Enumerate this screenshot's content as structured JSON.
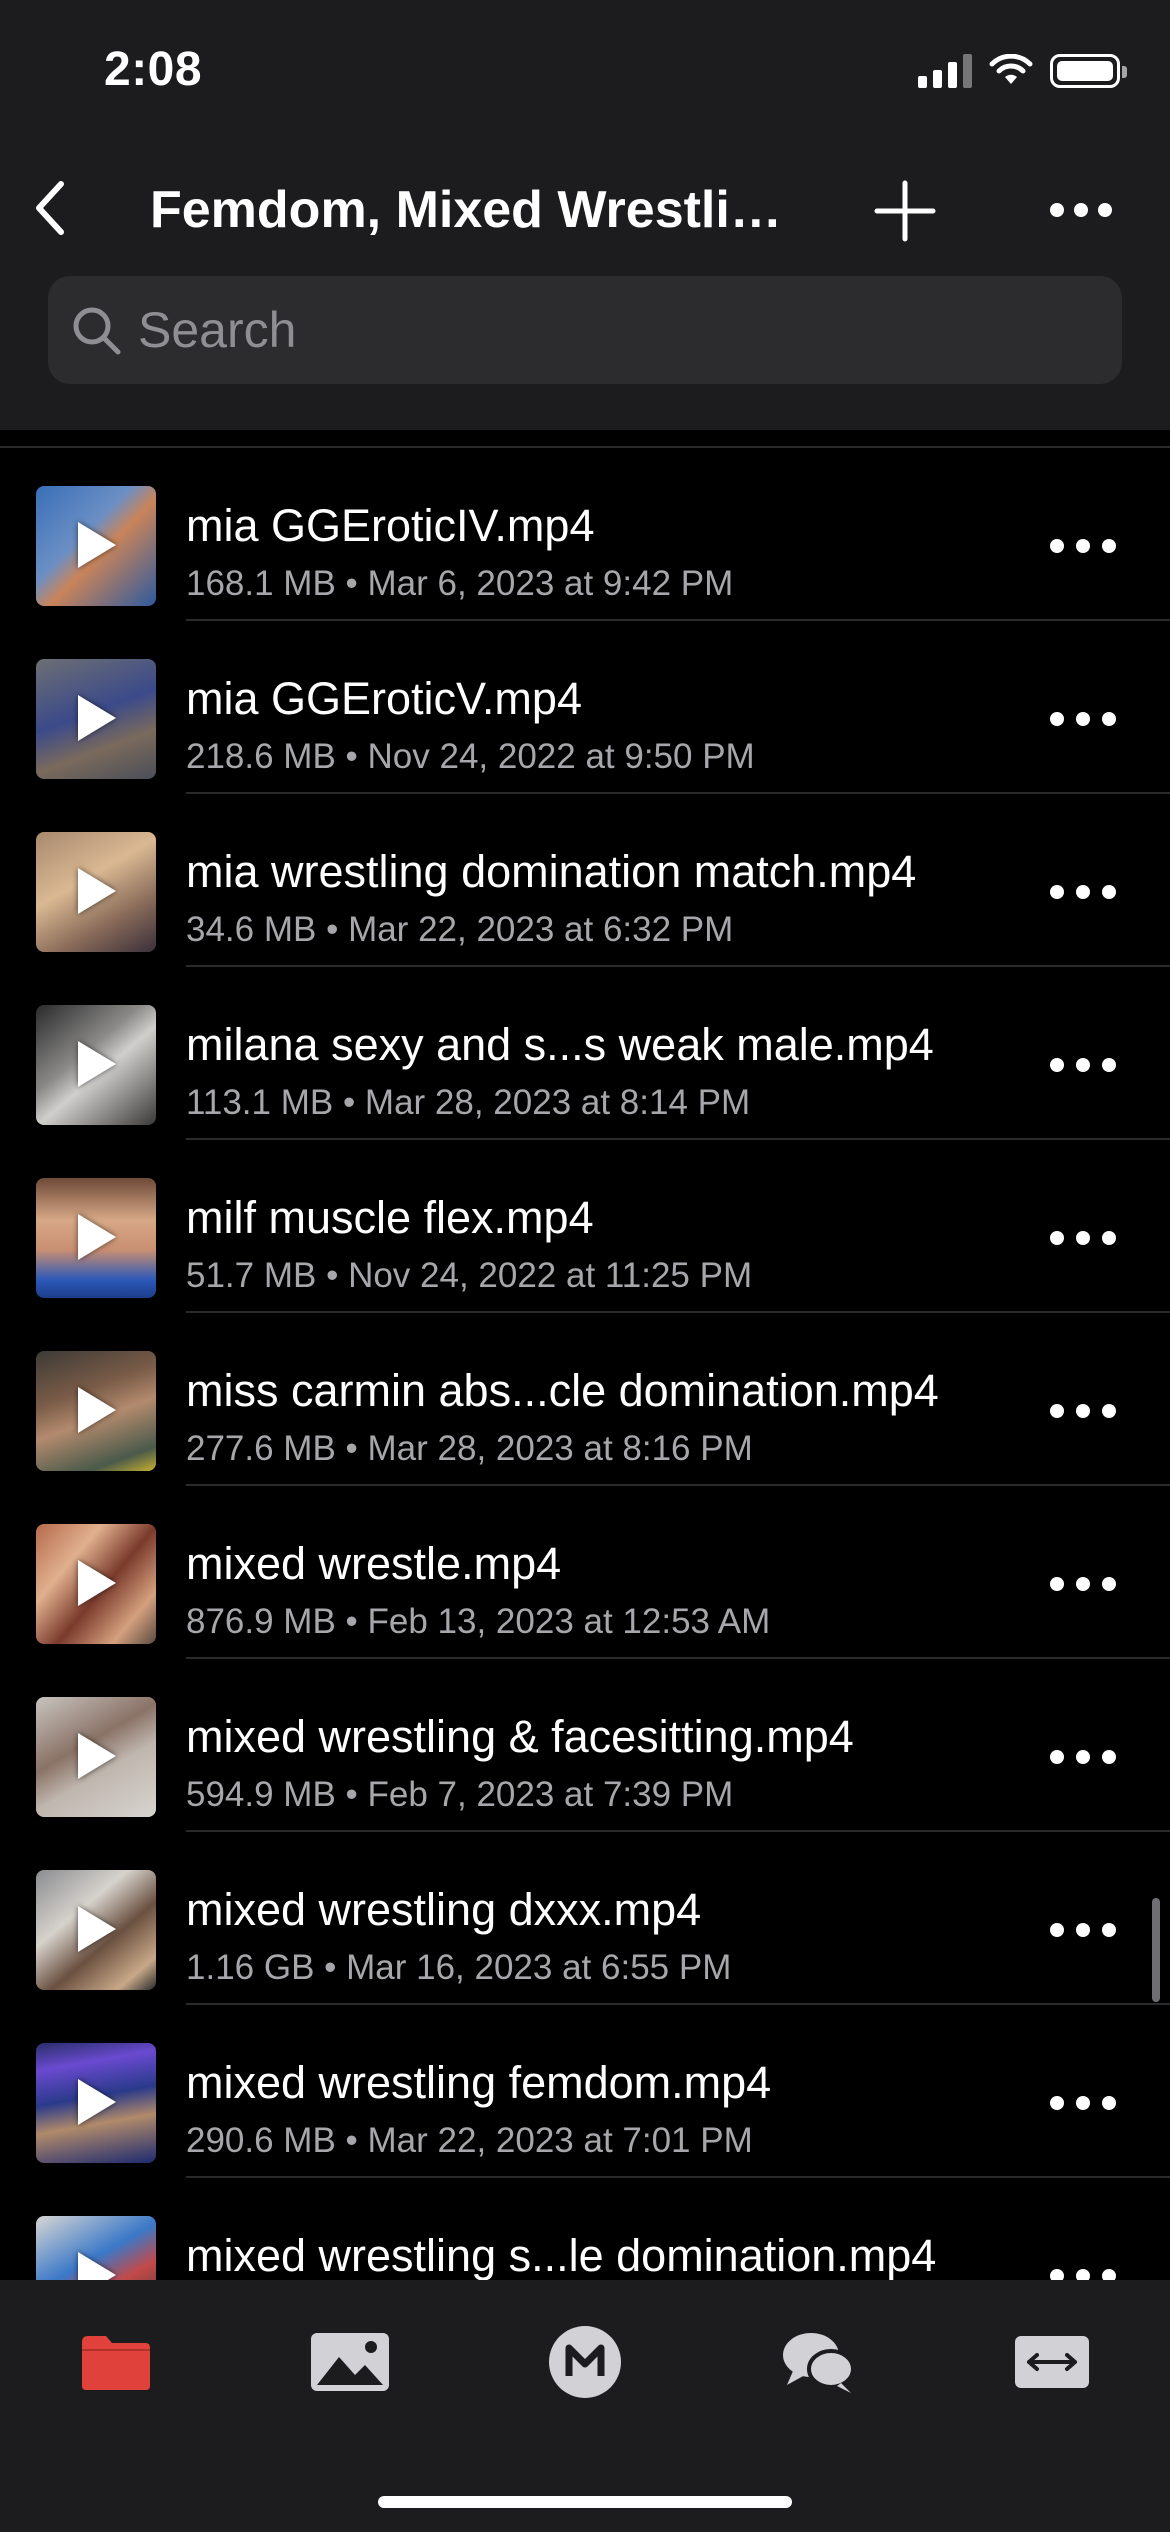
{
  "status_bar": {
    "time": "2:08"
  },
  "nav": {
    "title": "Femdom, Mixed Wrestlin..."
  },
  "search": {
    "placeholder": "Search"
  },
  "colors": {
    "accent": "#e0413a",
    "background": "#000000",
    "header": "#1c1c1e"
  },
  "files": [
    {
      "name": "mia GGEroticIV.mp4",
      "size": "168.1 MB",
      "date": "Mar 6, 2023 at 9:42 PM"
    },
    {
      "name": "mia GGEroticV.mp4",
      "size": "218.6 MB",
      "date": "Nov 24, 2022 at 9:50 PM"
    },
    {
      "name": "mia wrestling domination match.mp4",
      "size": "34.6 MB",
      "date": "Mar 22, 2023 at 6:32 PM"
    },
    {
      "name": "milana sexy and s...s weak male.mp4",
      "size": "113.1 MB",
      "date": "Mar 28, 2023 at 8:14 PM"
    },
    {
      "name": "milf muscle flex.mp4",
      "size": "51.7 MB",
      "date": "Nov 24, 2022 at 11:25 PM"
    },
    {
      "name": "miss carmin abs...cle domination.mp4",
      "size": "277.6 MB",
      "date": "Mar 28, 2023 at 8:16 PM"
    },
    {
      "name": "mixed wrestle.mp4",
      "size": "876.9 MB",
      "date": "Feb 13, 2023 at 12:53 AM"
    },
    {
      "name": "mixed wrestling & facesitting.mp4",
      "size": "594.9 MB",
      "date": "Feb 7, 2023 at 7:39 PM"
    },
    {
      "name": "mixed wrestling dxxx.mp4",
      "size": "1.16 GB",
      "date": "Mar 16, 2023 at 6:55 PM"
    },
    {
      "name": "mixed wrestling femdom.mp4",
      "size": "290.6 MB",
      "date": "Mar 22, 2023 at 7:01 PM"
    },
    {
      "name": "mixed wrestling s...le domination.mp4",
      "size": "",
      "date": ""
    }
  ],
  "tabs": [
    {
      "name": "files",
      "icon": "folder-icon",
      "active": true
    },
    {
      "name": "photos",
      "icon": "photo-icon",
      "active": false
    },
    {
      "name": "mega",
      "icon": "mega-logo-icon",
      "active": false
    },
    {
      "name": "chat",
      "icon": "chat-icon",
      "active": false
    },
    {
      "name": "transfers",
      "icon": "transfers-icon",
      "active": false
    }
  ]
}
